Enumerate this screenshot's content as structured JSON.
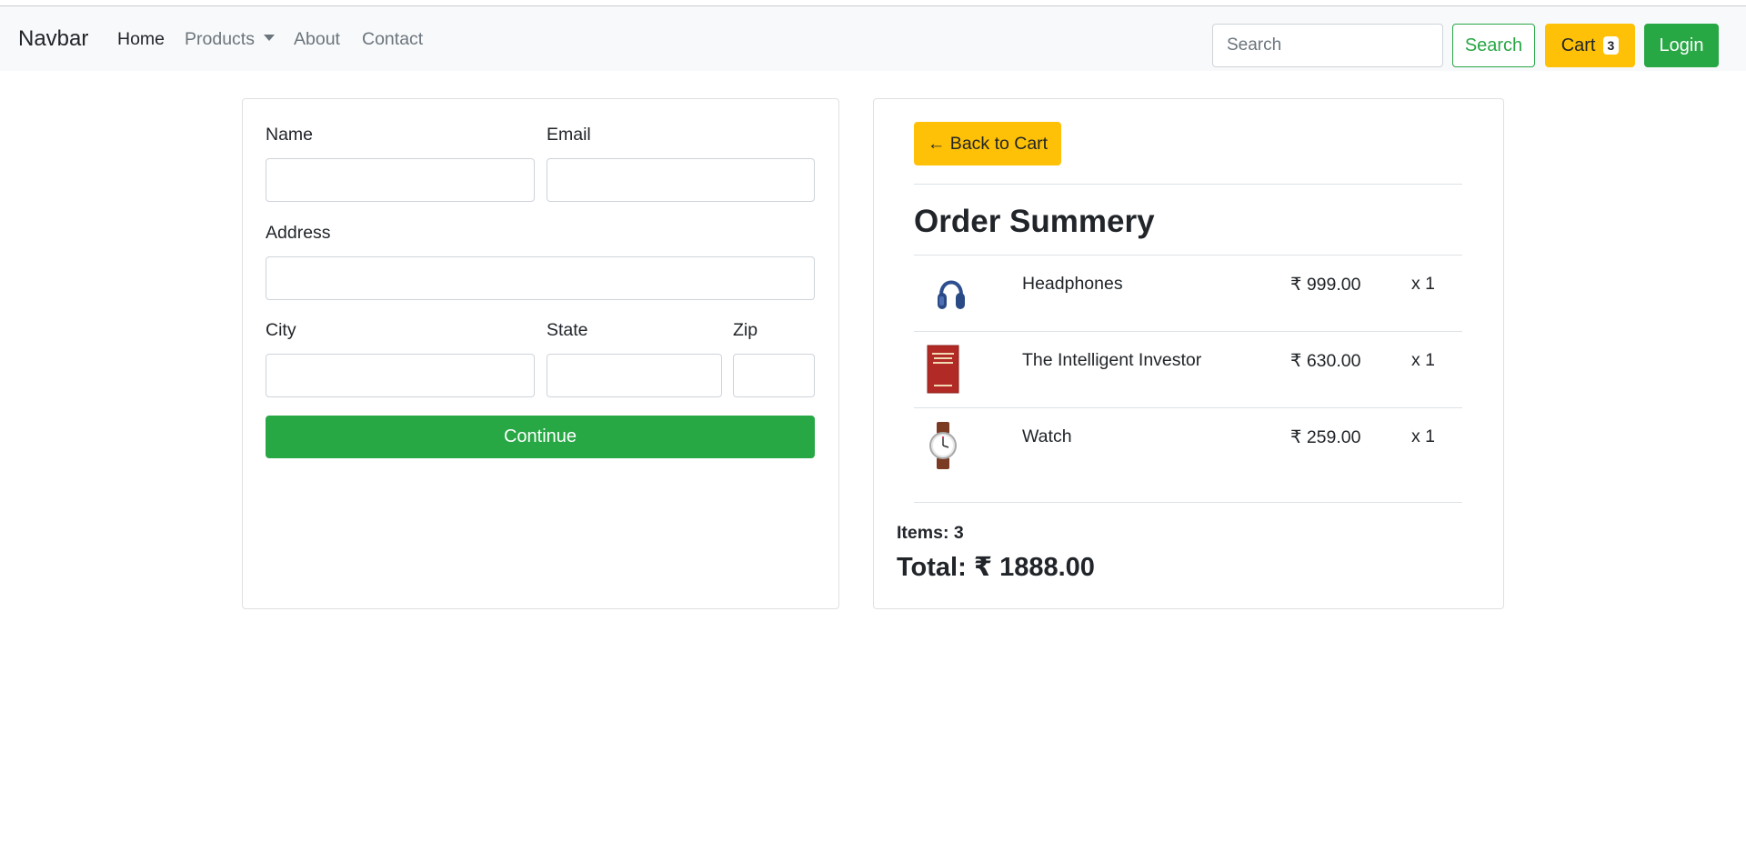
{
  "navbar": {
    "brand": "Navbar",
    "links": {
      "home": "Home",
      "products": "Products",
      "about": "About",
      "contact": "Contact"
    },
    "search_placeholder": "Search",
    "search_button": "Search",
    "cart_label": "Cart",
    "cart_count": "3",
    "login_button": "Login"
  },
  "form": {
    "name_label": "Name",
    "email_label": "Email",
    "address_label": "Address",
    "city_label": "City",
    "state_label": "State",
    "zip_label": "Zip",
    "continue_button": "Continue"
  },
  "summary": {
    "back_button": "← Back to Cart",
    "title": "Order Summery",
    "items": [
      {
        "name": "Headphones",
        "price": "₹ 999.00",
        "qty": "x 1",
        "icon": "headphones-icon"
      },
      {
        "name": "The Intelligent Investor",
        "price": "₹ 630.00",
        "qty": "x 1",
        "icon": "book-icon"
      },
      {
        "name": "Watch",
        "price": "₹ 259.00",
        "qty": "x 1",
        "icon": "watch-icon"
      }
    ],
    "items_count": "Items: 3",
    "total": "Total: ₹ 1888.00"
  },
  "colors": {
    "success": "#28a745",
    "warning": "#ffc107",
    "navbar_bg": "#f8f9fa"
  }
}
